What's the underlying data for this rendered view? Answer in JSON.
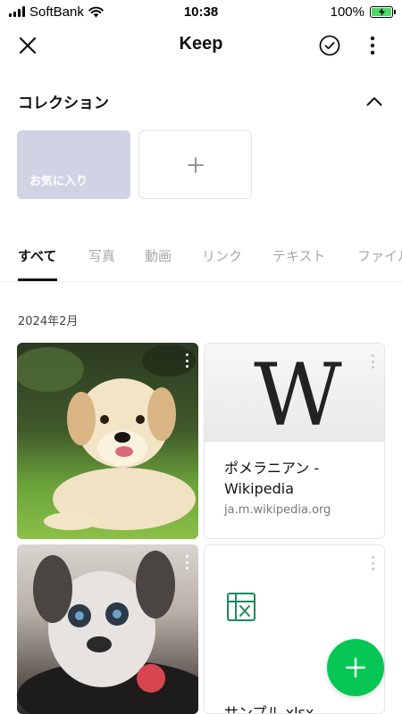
{
  "status_bar": {
    "carrier": "SoftBank",
    "time": "10:38",
    "battery": "100%",
    "battery_level": 100
  },
  "header": {
    "title": "Keep",
    "close_icon": "close-icon",
    "check_icon": "check-circle-icon",
    "more_icon": "more-vertical-icon"
  },
  "collection": {
    "title": "コレクション",
    "favorites_label": "お気に入り",
    "add_symbol": "+"
  },
  "tabs": [
    {
      "label": "すべて",
      "active": true
    },
    {
      "label": "写真",
      "active": false
    },
    {
      "label": "動画",
      "active": false
    },
    {
      "label": "リンク",
      "active": false
    },
    {
      "label": "テキスト",
      "active": false
    },
    {
      "label": "ファイル",
      "active": false
    }
  ],
  "date_group": "2024年2月",
  "items": {
    "link": {
      "title": "ポメラニアン - Wikipedia",
      "domain": "ja.m.wikipedia.org",
      "thumb_letter": "W"
    },
    "file": {
      "name": "サンプル.xlsx"
    }
  },
  "colors": {
    "accent_green": "#06c755",
    "favorites_bg": "#cfd3e4",
    "excel_green": "#1b8a5a"
  }
}
